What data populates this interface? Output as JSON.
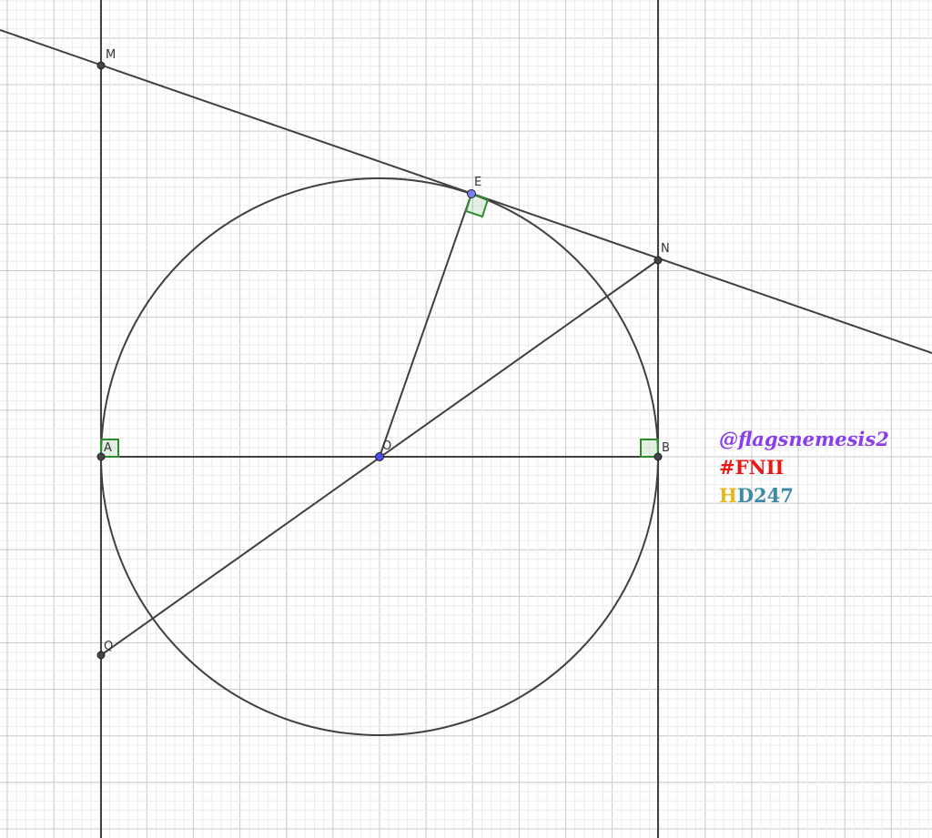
{
  "points": [
    {
      "label": "M",
      "color": "#444444"
    },
    {
      "label": "E",
      "color": "#7d7df5"
    },
    {
      "label": "N",
      "color": "#444444"
    },
    {
      "label": "A",
      "color": "#444444"
    },
    {
      "label": "O",
      "color": "#4b4bf0"
    },
    {
      "label": "B",
      "color": "#444444"
    },
    {
      "label": "Q",
      "color": "#444444"
    }
  ],
  "watermark": {
    "handle": "@flagsnemesis2",
    "tag": "#FNII",
    "code_h": "H",
    "code_rest": "D247",
    "colors": {
      "handle": "#8a3cf0",
      "tag": "#e81818",
      "h": "#e8b81c",
      "rest": "#3e8aa6"
    }
  },
  "colors": {
    "line": "#404040",
    "right_angle": "#2e8b2e",
    "grid_major": "#c8c8c8",
    "grid_minor": "#ececec"
  }
}
